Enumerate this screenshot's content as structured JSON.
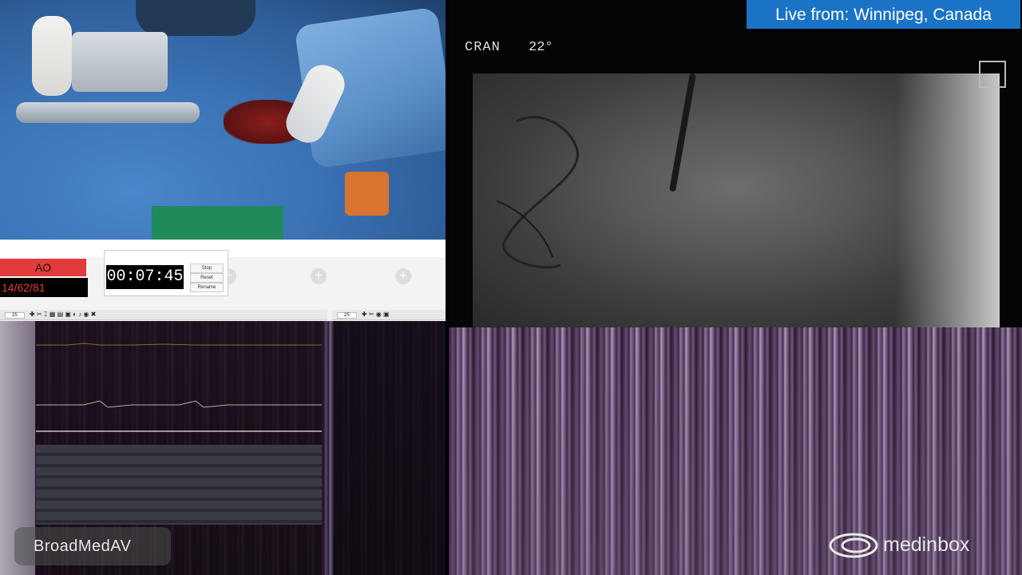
{
  "broadcast": {
    "live_banner": "Live from: Winnipeg, Canada",
    "watermark_left": "BroadMedAV",
    "watermark_right": "medinbox"
  },
  "angio": {
    "projection": "CRAN",
    "angle": "22°"
  },
  "hemo_app": {
    "channel_label": "AO",
    "pressure_reading": "14/62/81",
    "timer": "00:07:45",
    "timer_buttons": [
      "Stop",
      "Reset",
      "Rename"
    ],
    "toolbar_values": [
      "25",
      "25"
    ]
  },
  "colors": {
    "banner_blue": "#1a73c7",
    "ao_red": "#e23b3b"
  }
}
